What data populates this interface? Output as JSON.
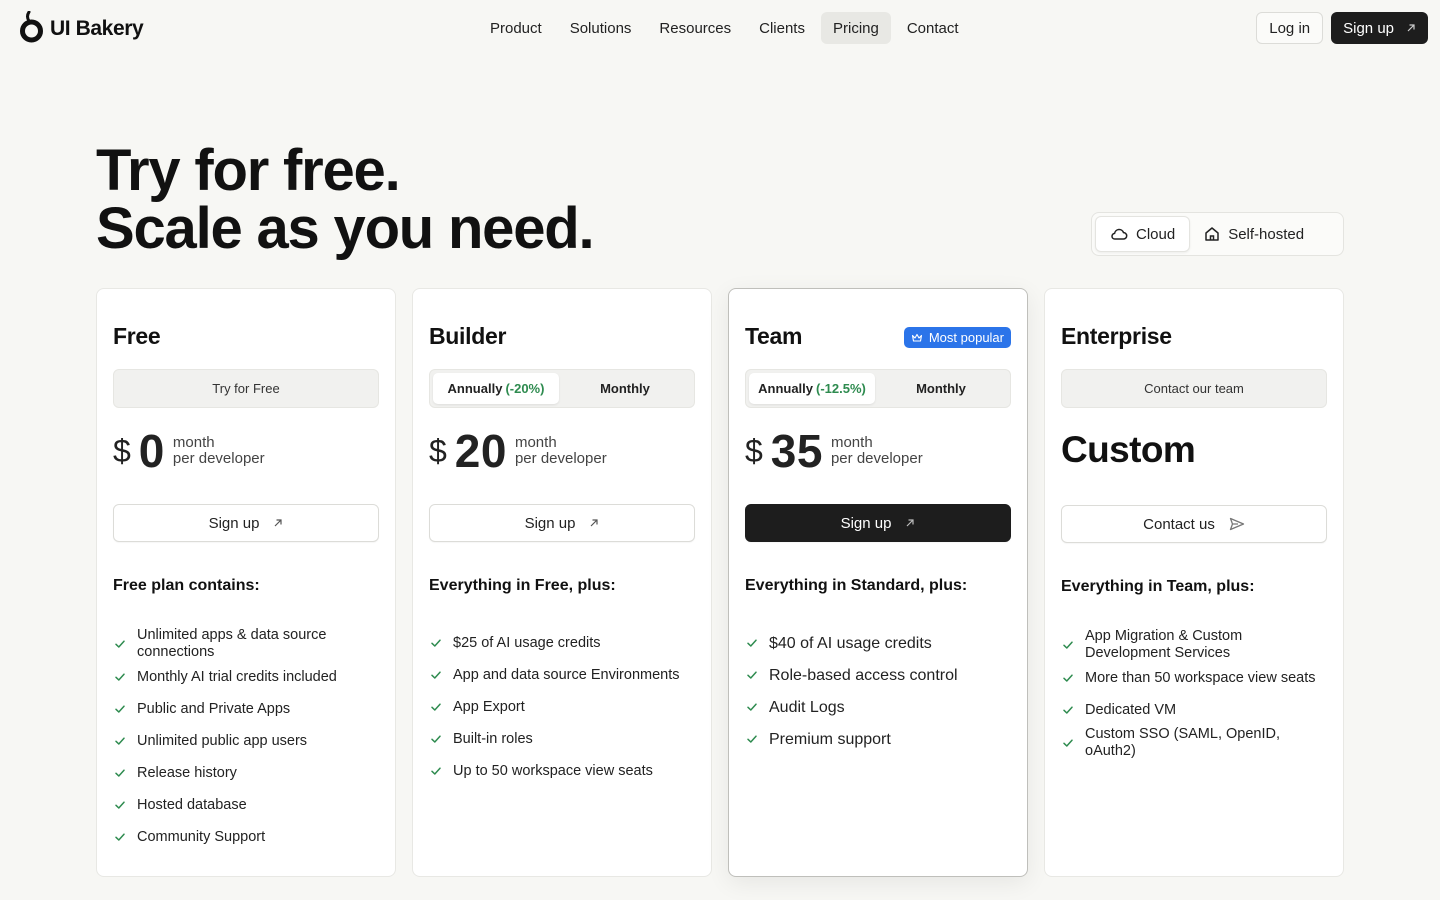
{
  "brand": {
    "name": "UI Bakery"
  },
  "nav": {
    "items": [
      {
        "label": "Product"
      },
      {
        "label": "Solutions"
      },
      {
        "label": "Resources"
      },
      {
        "label": "Clients"
      },
      {
        "label": "Pricing",
        "active": true
      },
      {
        "label": "Contact"
      }
    ],
    "login": "Log in",
    "signup": "Sign up"
  },
  "hero": {
    "line1": "Try for free.",
    "line2": "Scale as you need."
  },
  "deployment": {
    "options": [
      {
        "label": "Cloud",
        "icon": "cloud-icon",
        "selected": true
      },
      {
        "label": "Self-hosted",
        "icon": "house-icon",
        "selected": false
      }
    ]
  },
  "colors": {
    "accent_badge": "#2b74e9",
    "discount": "#2e8b4f",
    "dark_button": "#1d1d1d",
    "check": "#2e8b4f"
  },
  "plans": [
    {
      "name": "Free",
      "plan_box": "Try for Free",
      "currency": "$",
      "price": "0",
      "period": "month",
      "unit": "per developer",
      "cta": "Sign up",
      "features_heading": "Free plan contains:",
      "features": [
        "Unlimited apps & data source connections",
        "Monthly AI trial credits included",
        "Public and Private Apps",
        "Unlimited public app users",
        "Release history",
        "Hosted database",
        "Community Support"
      ]
    },
    {
      "name": "Builder",
      "billing": {
        "annual": "Annually",
        "annual_discount": "(-20%)",
        "monthly": "Monthly",
        "selected": "annual"
      },
      "currency": "$",
      "price": "20",
      "period": "month",
      "unit": "per developer",
      "cta": "Sign up",
      "features_heading": "Everything in Free, plus:",
      "features": [
        "$25 of AI usage credits",
        "App and data source Environments",
        "App Export",
        "Built-in roles",
        "Up to 50 workspace view seats"
      ]
    },
    {
      "name": "Team",
      "badge": "Most popular",
      "billing": {
        "annual": "Annually",
        "annual_discount": "(-12.5%)",
        "monthly": "Monthly",
        "selected": "annual"
      },
      "currency": "$",
      "price": "35",
      "period": "month",
      "unit": "per developer",
      "cta": "Sign up",
      "features_heading": "Everything in Standard, plus:",
      "features": [
        "$40 of AI usage credits",
        "Role-based access control",
        "Audit Logs",
        "Premium support"
      ]
    },
    {
      "name": "Enterprise",
      "plan_box": "Contact our team",
      "price_label": "Custom",
      "cta": "Contact us",
      "features_heading": "Everything in Team, plus:",
      "features": [
        "App Migration & Custom Development Services",
        "More than 50 workspace view seats",
        "Dedicated VM",
        "Custom SSO (SAML, OpenID, oAuth2)"
      ]
    }
  ]
}
